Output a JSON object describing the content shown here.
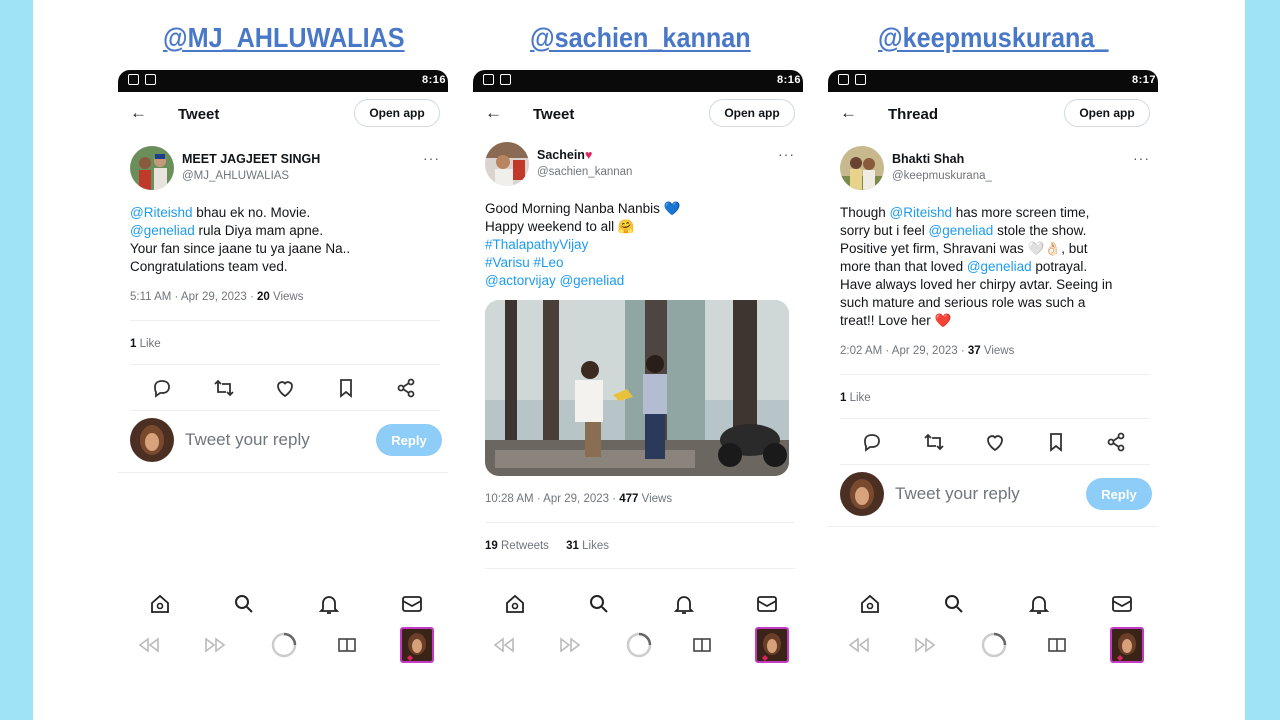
{
  "headings": [
    "@MJ_AHLUWALIAS",
    "@sachien_kannan",
    "@keepmuskurana_"
  ],
  "status_time": "8:16",
  "status_time_p3": "8:17",
  "open_app_label": "Open app",
  "reply_placeholder": "Tweet your reply",
  "reply_button": "Reply",
  "panels": [
    {
      "topbar_title": "Tweet",
      "name": "MEET JAGJEET SINGH",
      "handle": "@MJ_AHLUWALIAS",
      "lines": [
        {
          "link": "@Riteishd",
          "text": " bhau ek no. Movie."
        },
        {
          "link": "@geneliad",
          "text": " rula Diya mam apne."
        },
        {
          "link": "",
          "text": "Your fan since jaane tu ya jaane Na.."
        },
        {
          "link": "",
          "text": "Congratulations team ved."
        }
      ],
      "timestamp": "5:11 AM · Apr 29, 2023 · ",
      "views_count": "20",
      "views_label": " Views",
      "likes_count": "1",
      "likes_label": " Like"
    },
    {
      "topbar_title": "Tweet",
      "name": "Sachein",
      "name_emoji": "♥",
      "handle": "@sachien_kannan",
      "lines": [
        {
          "text": "Good Morning Nanba Nanbis",
          "emoji": "💙"
        },
        {
          "text": "Happy weekend to all",
          "emoji": "🤗"
        }
      ],
      "link_lines": [
        "#ThalapathyVijay",
        "#Varisu #Leo",
        "@actorvijay @geneliad"
      ],
      "timestamp": "10:28 AM · Apr 29, 2023 · ",
      "views_count": "477",
      "views_label": " Views",
      "retweets_count": "19",
      "retweets_label": " Retweets",
      "likes_count": "31",
      "likes_label": " Likes"
    },
    {
      "topbar_title": "Thread",
      "name": "Bhakti Shah",
      "handle": "@keepmuskurana_",
      "lines": [
        {
          "pre": "Though ",
          "link": "@Riteishd",
          "post": " has more screen time,"
        },
        {
          "pre": "sorry but i feel ",
          "link": "@geneliad",
          "post": " stole the show."
        },
        {
          "pre": "Positive yet firm, Shravani was ",
          "link": "",
          "post": "🤍👌🏻, but"
        },
        {
          "pre": "more than that loved ",
          "link": "@geneliad",
          "post": " potrayal."
        },
        {
          "pre": "Have always loved her chirpy avtar. Seeing in",
          "link": "",
          "post": ""
        },
        {
          "pre": "such mature and serious role was such a",
          "link": "",
          "post": ""
        },
        {
          "pre": "treat!! Love her ",
          "link": "",
          "post": "❤️"
        }
      ],
      "timestamp": "2:02 AM · Apr 29, 2023 · ",
      "views_count": "37",
      "views_label": " Views",
      "likes_count": "1",
      "likes_label": " Like"
    }
  ],
  "icons": {
    "back": "back-arrow-icon",
    "reply": "reply-icon",
    "retweet": "retweet-icon",
    "like": "heart-icon",
    "bookmark": "bookmark-icon",
    "share": "share-icon",
    "home": "home-icon",
    "search": "search-icon",
    "notifications": "bell-icon",
    "messages": "mail-icon"
  },
  "colors": {
    "background": "#9fe3f6",
    "heading": "#4a78c8",
    "link": "#1d9bf0",
    "reply_button": "#8ecdf8"
  }
}
